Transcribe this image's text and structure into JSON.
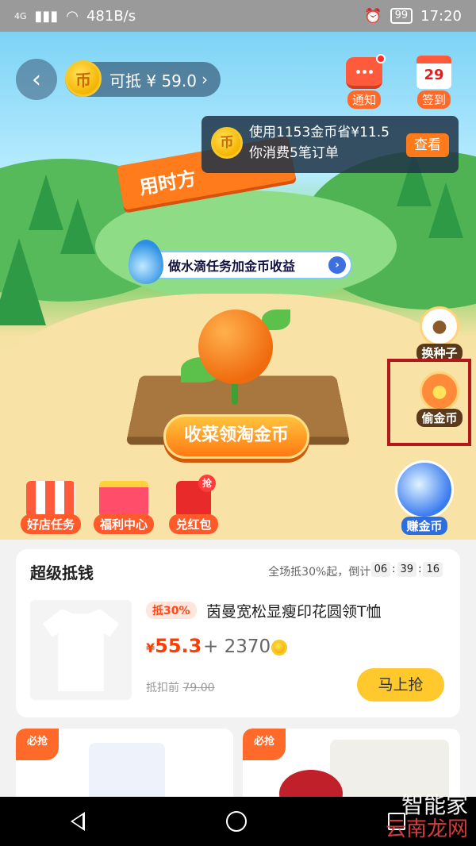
{
  "status_bar": {
    "network": "4G",
    "speed": "481B/s",
    "battery": "99",
    "time": "17:20"
  },
  "header": {
    "coin_label": "可抵 ¥ 59.0",
    "coin_symbol": "币",
    "notify_label": "通知",
    "checkin_label": "签到",
    "checkin_day": "29"
  },
  "tooltip": {
    "line1": "使用1153金币省¥11.5",
    "line2": "你消费5笔订单",
    "view_label": "查看"
  },
  "banner": {
    "text": "用时方"
  },
  "water_task": {
    "label": "做水滴任务加金币收益"
  },
  "harvest": {
    "label": "收菜领淘金币"
  },
  "side_actions": {
    "change_seed": "换种子",
    "steal_coins": "偷金币",
    "earn_coins": "赚金币"
  },
  "bottom_icons": {
    "shop_tasks": "好店任务",
    "welfare": "福利中心",
    "redeem": "兑红包",
    "grab_badge": "抢"
  },
  "super_deal": {
    "title": "超级抵钱",
    "subtitle": "全场抵30%起，倒计时:",
    "countdown": [
      "06",
      "39",
      "16"
    ],
    "tag": "抵30%",
    "product_name": "茵曼宽松显瘦印花圆领T恤",
    "price_symbol": "¥",
    "price": "55.3",
    "plus_coins": "+ 2370",
    "before_label": "抵扣前",
    "before_price": "79.00",
    "buy_label": "马上抢"
  },
  "grid": {
    "must_tag": "必抢"
  },
  "watermark": {
    "line1": "智能家",
    "line2": "云南龙网"
  },
  "colors": {
    "accent": "#ff7a12",
    "price": "#ff3d00",
    "buy_button": "#ffc82c",
    "highlight_box": "#b21818"
  }
}
